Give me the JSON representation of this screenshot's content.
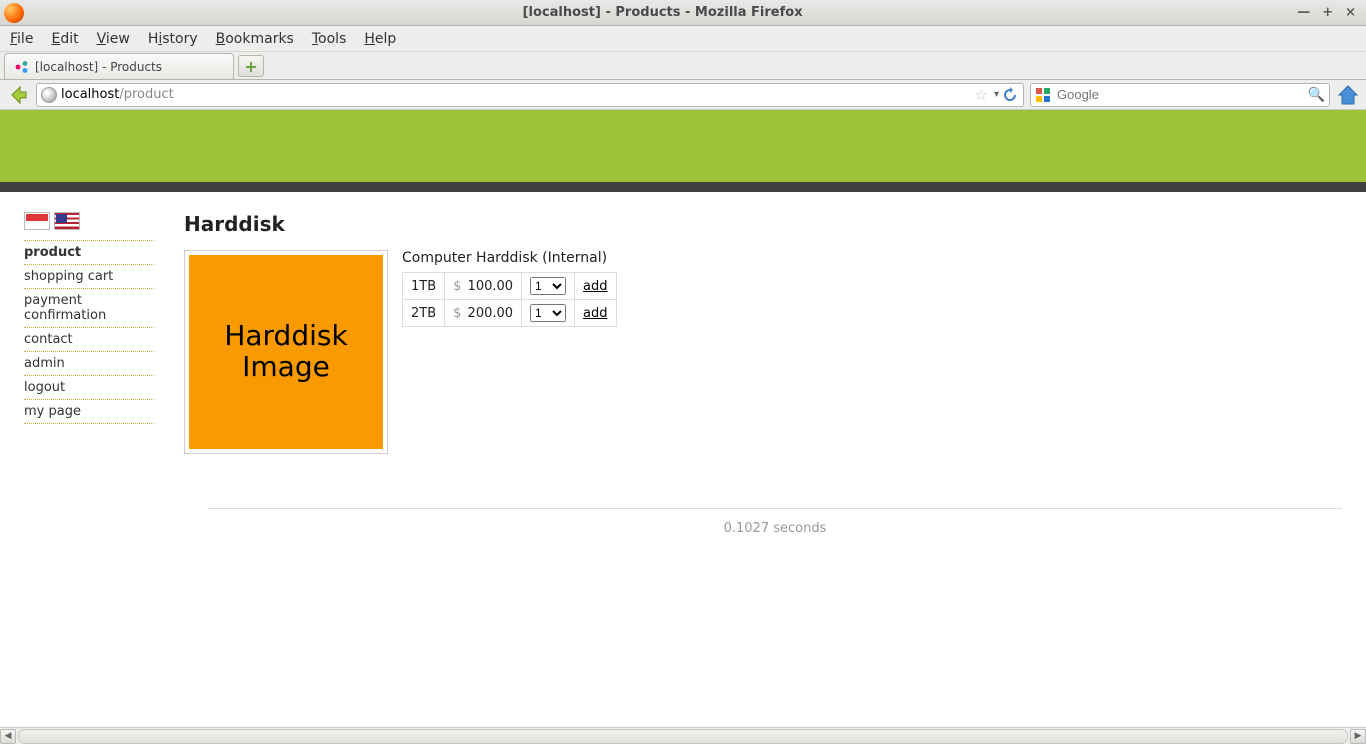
{
  "window": {
    "title": "[localhost] - Products - Mozilla Firefox"
  },
  "menu": {
    "file": "File",
    "edit": "Edit",
    "view": "View",
    "history": "History",
    "bookmarks": "Bookmarks",
    "tools": "Tools",
    "help": "Help"
  },
  "tab": {
    "label": "[localhost] - Products"
  },
  "url": {
    "host": "localhost",
    "path": "/product"
  },
  "search": {
    "placeholder": "Google"
  },
  "sidebar": {
    "items": [
      {
        "label": "product",
        "active": true
      },
      {
        "label": "shopping cart",
        "active": false
      },
      {
        "label": "payment confirmation",
        "active": false
      },
      {
        "label": "contact",
        "active": false
      },
      {
        "label": "admin",
        "active": false
      },
      {
        "label": "logout",
        "active": false
      },
      {
        "label": "my page",
        "active": false
      }
    ]
  },
  "product": {
    "title": "Harddisk",
    "image_label": "Harddisk Image",
    "description": "Computer Harddisk (Internal)",
    "variants": [
      {
        "size": "1TB",
        "currency": "$",
        "price": "100.00",
        "qty": "1",
        "action": "add"
      },
      {
        "size": "2TB",
        "currency": "$",
        "price": "200.00",
        "qty": "1",
        "action": "add"
      }
    ]
  },
  "footer": {
    "timing": "0.1027 seconds"
  }
}
